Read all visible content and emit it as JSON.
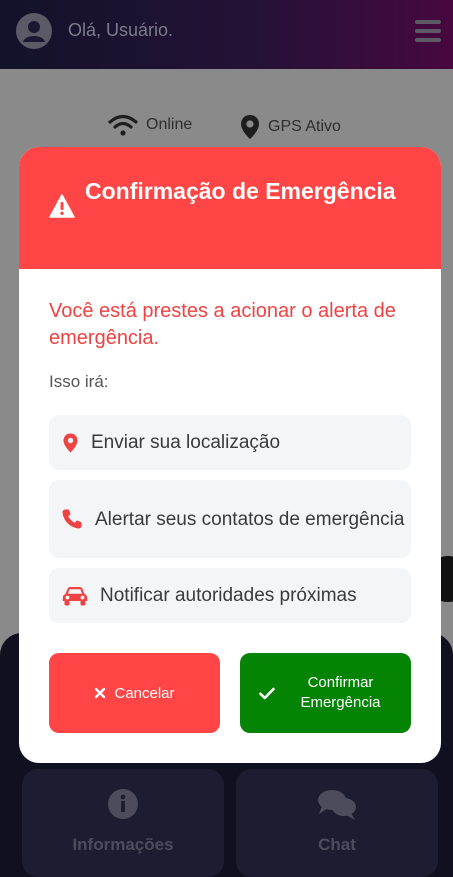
{
  "header": {
    "greeting": "Olá, Usuário."
  },
  "status": {
    "online_label": "Online",
    "gps_label": "GPS Ativo"
  },
  "modal": {
    "title": "Confirmação de Emergência",
    "lead": "Você está prestes a acionar o alerta de emergência.",
    "subtitle": "Isso irá:",
    "actions": [
      {
        "icon": "map-pin-icon",
        "label": "Enviar sua localização"
      },
      {
        "icon": "phone-icon",
        "label": "Alertar seus contatos de emergência"
      },
      {
        "icon": "car-icon",
        "label": "Notificar autoridades próximas"
      }
    ],
    "cancel_label": "Cancelar",
    "confirm_label": "Confirmar Emergência"
  },
  "bottom_nav": {
    "info_label": "Informações",
    "chat_label": "Chat"
  },
  "colors": {
    "danger": "#ff4545",
    "confirm": "#058305",
    "header_gradient_start": "#13122a",
    "header_gradient_end": "#47083f"
  }
}
